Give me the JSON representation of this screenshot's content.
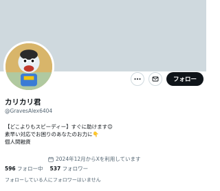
{
  "profile": {
    "display_name": "カリカリ君",
    "handle": "@GravesAlex6404",
    "bio_lines": [
      "【どこよりもスピーディー】すぐに助けます😊",
      "素早い対応でお困りのあなたのお力に👇",
      "個人間融資"
    ],
    "joined": "2024年12月からXを利用しています"
  },
  "actions": {
    "more_icon": "more-icon",
    "message_icon": "message-icon",
    "follow_label": "フォロー"
  },
  "stats": {
    "following_count": "596",
    "following_label": "フォロー中",
    "followers_count": "537",
    "followers_label": "フォロワー"
  },
  "mutual_note": "フォローしている人にフォロワーはいません",
  "colors": {
    "banner": "#cfd9de",
    "primary_text": "#0f1419",
    "secondary_text": "#536471",
    "follow_button": "#0f1419"
  }
}
